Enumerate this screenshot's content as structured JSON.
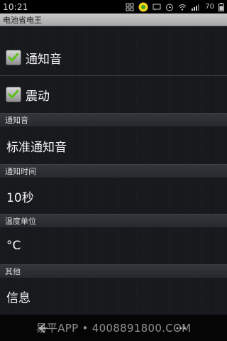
{
  "status_bar": {
    "time": "10:21",
    "battery_level": "70",
    "icons": [
      "grid-icon",
      "app-badge-icon",
      "message-icon",
      "alarm-icon",
      "wifi-icon",
      "signal-icon",
      "battery-icon"
    ]
  },
  "title_bar": {
    "title": "电池省电王"
  },
  "settings": {
    "notify_sound_checkbox": {
      "label": "通知音",
      "checked": true
    },
    "vibrate_checkbox": {
      "label": "震动",
      "checked": true
    },
    "sections": [
      {
        "header": "通知音",
        "value": "标准通知音"
      },
      {
        "header": "通知时间",
        "value": "10秒"
      },
      {
        "header": "温度单位",
        "value": "°C"
      },
      {
        "header": "其他",
        "value": "信息"
      }
    ]
  },
  "bottom_bar": {
    "watermark": "易平APP • 4008891800.COM"
  },
  "colors": {
    "check_green": "#5cc21a",
    "background": "#16181c",
    "header_bg": "#2c2f34"
  }
}
